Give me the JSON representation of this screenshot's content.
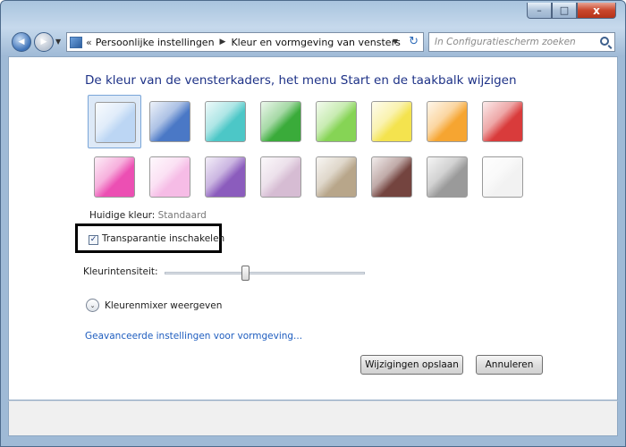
{
  "window": {
    "caption": {
      "minimize": "–",
      "maximize": "□",
      "close": "x"
    }
  },
  "navigation": {
    "back_glyph": "◀",
    "forward_glyph": "▶",
    "address": {
      "prefix_sep": "«",
      "crumbs": [
        "Persoonlijke instellingen",
        "Kleur en vormgeving van vensters"
      ],
      "crumb_sep": "▶",
      "dropdown": "▼",
      "refresh": "↻"
    },
    "search": {
      "placeholder": "In Configuratiescherm zoeken"
    }
  },
  "main": {
    "heading": "De kleur van de vensterkaders, het menu Start en de taakbalk wijzigen",
    "swatches": [
      {
        "color": "#bcd6f4",
        "selected": true
      },
      {
        "color": "#4a78c6",
        "selected": false
      },
      {
        "color": "#4cc7c7",
        "selected": false
      },
      {
        "color": "#3aab3a",
        "selected": false
      },
      {
        "color": "#86d455",
        "selected": false
      },
      {
        "color": "#f4e34e",
        "selected": false
      },
      {
        "color": "#f6a531",
        "selected": false
      },
      {
        "color": "#d93b3b",
        "selected": false
      },
      {
        "color": "#ec4fb3",
        "selected": false
      },
      {
        "color": "#f6bce6",
        "selected": false
      },
      {
        "color": "#8b5cbd",
        "selected": false
      },
      {
        "color": "#d6bcd3",
        "selected": false
      },
      {
        "color": "#b8a68a",
        "selected": false
      },
      {
        "color": "#74443f",
        "selected": false
      },
      {
        "color": "#9a9a9a",
        "selected": false
      },
      {
        "color": "#f2f2f2",
        "selected": false
      }
    ],
    "current_color": {
      "label": "Huidige kleur:",
      "value": "Standaard"
    },
    "transparency": {
      "label": "Transparantie inschakelen",
      "checked": true,
      "check_glyph": "✓"
    },
    "intensity": {
      "label": "Kleurintensiteit:",
      "level": 0.4
    },
    "mixer": {
      "label": "Kleurenmixer weergeven",
      "chevron": "⌄"
    },
    "advanced_link": "Geavanceerde instellingen voor vormgeving..."
  },
  "footer": {
    "save_label": "Wijzigingen opslaan",
    "cancel_label": "Annuleren"
  }
}
